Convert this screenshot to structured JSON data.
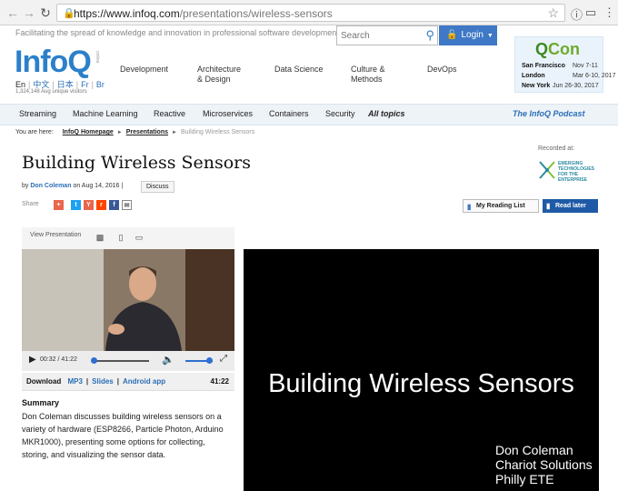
{
  "browser": {
    "url_host": "https://www.infoq.com",
    "url_path": "/presentations/wireless-sensors"
  },
  "header": {
    "tagline": "Facilitating the spread of knowledge and innovation in professional software development",
    "search_placeholder": "Search",
    "login_label": "Login",
    "logo_text_main": "Info",
    "logo_text_q": "Q",
    "logo_sub": "online",
    "languages": [
      "En",
      "中文",
      "日本",
      "Fr",
      "Br"
    ],
    "visitors": "1,324,148 Aug unique visitors",
    "nav_primary": [
      "Development",
      "Architecture\n& Design",
      "Data Science",
      "Culture &\nMethods",
      "DevOps"
    ]
  },
  "qcon": {
    "brand_q": "Q",
    "brand_rest": "Con",
    "events": [
      {
        "city": "San Francisco",
        "dates": "Nov 7-11"
      },
      {
        "city": "London",
        "dates": "Mar 6-10, 2017"
      },
      {
        "city": "New York",
        "dates": "Jun 26-30, 2017"
      }
    ]
  },
  "nav_secondary": {
    "items": [
      "Streaming",
      "Machine Learning",
      "Reactive",
      "Microservices",
      "Containers",
      "Security",
      "All topics"
    ],
    "podcast": "The InfoQ Podcast"
  },
  "breadcrumb": {
    "prefix": "You are here:",
    "items": [
      "InfoQ Homepage",
      "Presentations"
    ],
    "current": "Building Wireless Sensors"
  },
  "recorded": {
    "label": "Recorded at:",
    "logo_lines": [
      "EMERGING",
      "TECHNOLOGIES",
      "FOR THE ENTERPRISE"
    ]
  },
  "article": {
    "title": "Building Wireless Sensors",
    "by": "by",
    "author": "Don Coleman",
    "date": "on Aug 14, 2016 |",
    "discuss": "Discuss",
    "share_label": "Share",
    "reading_list": "My Reading List",
    "read_later": "Read later"
  },
  "player": {
    "view_label": "View Presentation",
    "time": "00:32 / 41:22",
    "progress": 0.013,
    "volume": 0.85,
    "download_label": "Download",
    "downloads": [
      "MP3",
      "Slides",
      "Android app"
    ],
    "duration": "41:22"
  },
  "summary": {
    "heading": "Summary",
    "text": "Don Coleman discusses building wireless sensors on a variety of hardware (ESP8266, Particle Photon, Arduino MKR1000), presenting some options for collecting, storing, and visualizing the sensor data."
  },
  "slide": {
    "title": "Building Wireless Sensors",
    "lines": [
      "Don Coleman",
      "Chariot Solutions",
      "Philly ETE"
    ]
  },
  "colors": {
    "brand_blue": "#2b80c9",
    "login_blue": "#3e78c6",
    "read_later_blue": "#1f5aa6",
    "qcon_green": "#6eaa2e"
  }
}
